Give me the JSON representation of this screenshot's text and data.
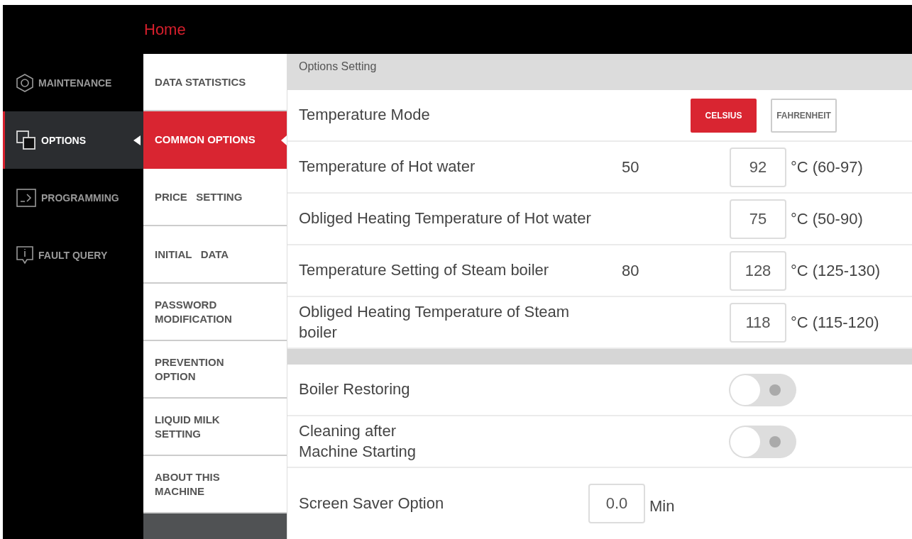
{
  "header": {
    "title": "Home"
  },
  "nav": [
    {
      "label": "MAINTENANCE",
      "selected": false
    },
    {
      "label": "OPTIONS",
      "selected": true
    },
    {
      "label": "PROGRAMMING",
      "selected": false
    },
    {
      "label": "FAULT QUERY",
      "selected": false
    }
  ],
  "submenu": [
    {
      "label": "DATA STATISTICS",
      "selected": false
    },
    {
      "label": "COMMON OPTIONS",
      "selected": true
    },
    {
      "label": "PRICE   SETTING",
      "selected": false
    },
    {
      "label": "INITIAL   DATA",
      "selected": false
    },
    {
      "label": "PASSWORD MODIFICATION",
      "selected": false
    },
    {
      "label": "PREVENTION OPTION",
      "selected": false
    },
    {
      "label": "LIQUID MILK SETTING",
      "selected": false
    },
    {
      "label": "ABOUT THIS MACHINE",
      "selected": false
    }
  ],
  "sections": [
    {
      "title": "Options Setting",
      "rows": [
        {
          "kind": "mode",
          "label": "Temperature Mode",
          "options": [
            {
              "label": "CELSIUS",
              "selected": true
            },
            {
              "label": "FAHRENHEIT",
              "selected": false
            }
          ]
        },
        {
          "kind": "number",
          "label": "Temperature of Hot water",
          "current": "50",
          "value": "92",
          "unit": "°C (60-97)"
        },
        {
          "kind": "number",
          "label": "Obliged Heating Temperature of Hot water",
          "value": "75",
          "unit": "°C (50-90)"
        },
        {
          "kind": "number",
          "label": "Temperature Setting of Steam boiler",
          "current": "80",
          "value": "128",
          "unit": "°C (125-130)"
        },
        {
          "kind": "number",
          "label": "Obliged Heating Temperature of Steam boiler",
          "value": "118",
          "unit": "°C (115-120)"
        }
      ]
    },
    {
      "rows": [
        {
          "kind": "toggle",
          "label": "Boiler Restoring",
          "on": false
        },
        {
          "kind": "toggle",
          "label": "Cleaning after Machine Starting",
          "on": false
        },
        {
          "kind": "inline",
          "label": "Screen Saver Option",
          "value": "0.0",
          "unit": "Min"
        }
      ]
    }
  ]
}
